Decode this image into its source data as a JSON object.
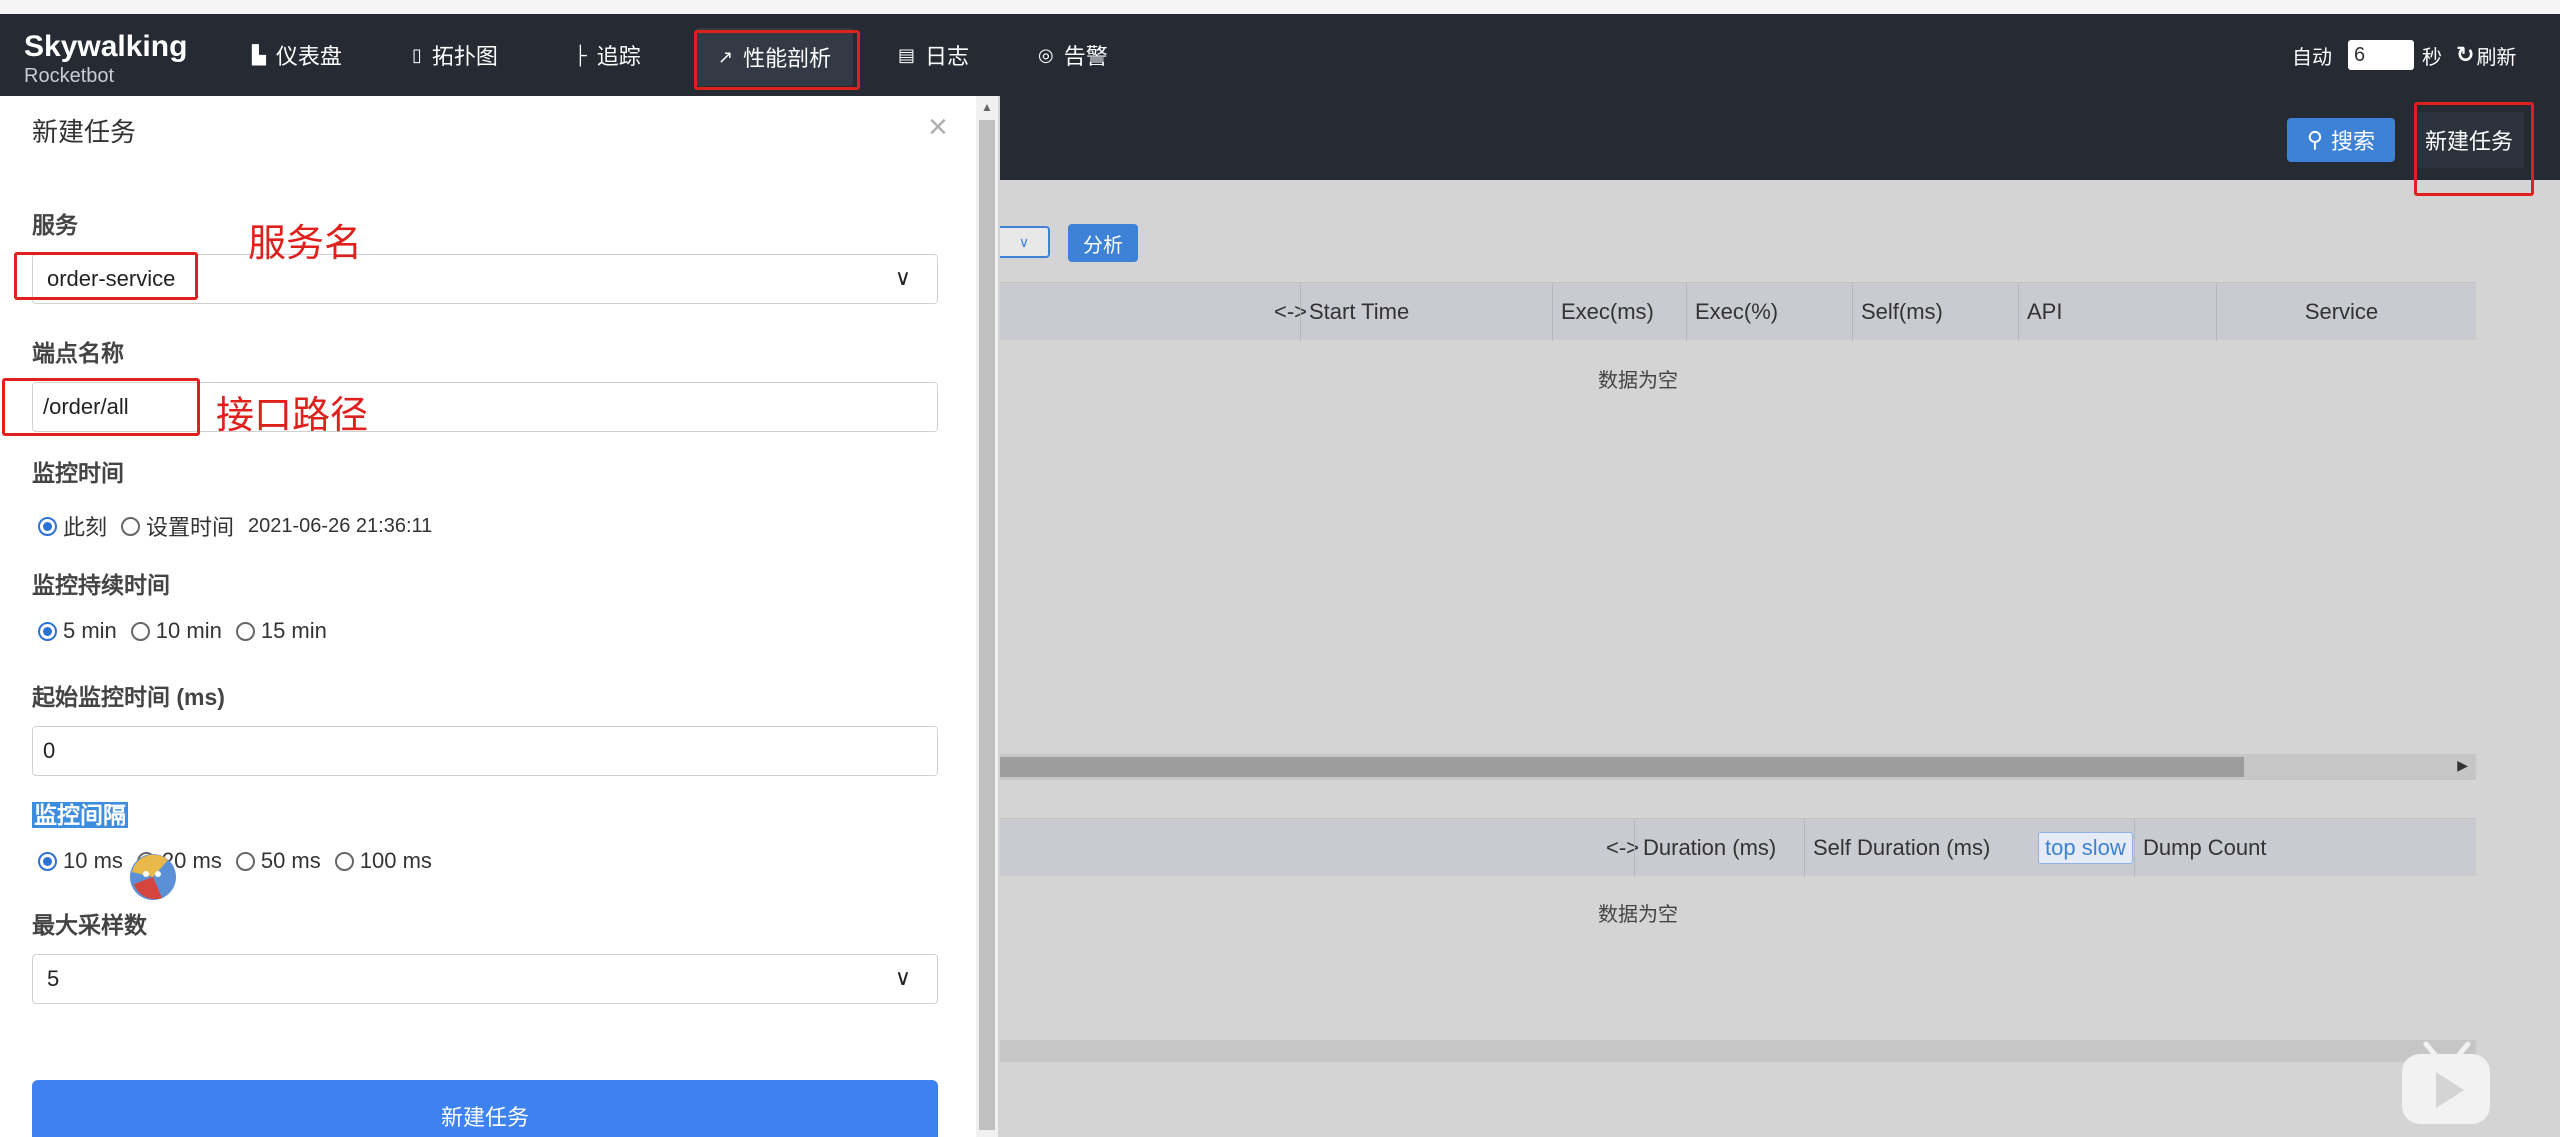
{
  "nav": {
    "logo_brand": "Skywalking",
    "logo_sub": "Rocketbot",
    "items": [
      {
        "icon": "chart-icon",
        "label": "仪表盘"
      },
      {
        "icon": "topology-icon",
        "label": "拓扑图"
      },
      {
        "icon": "trace-icon",
        "label": "追踪"
      },
      {
        "icon": "trend-icon",
        "label": "性能剖析"
      },
      {
        "icon": "log-icon",
        "label": "日志"
      },
      {
        "icon": "alarm-icon",
        "label": "告警"
      }
    ],
    "auto_label": "自动",
    "interval_value": "6",
    "seconds_label": "秒",
    "refresh_label": "刷新"
  },
  "toolbar": {
    "search_label": "搜索",
    "new_task_label": "新建任务",
    "analyze_label": "分析"
  },
  "top_table": {
    "toggle": "<->",
    "columns": [
      "Start Time",
      "Exec(ms)",
      "Exec(%)",
      "Self(ms)",
      "API",
      "Service"
    ],
    "empty": "数据为空"
  },
  "bottom_table": {
    "toggle": "<->",
    "columns": [
      "Duration (ms)",
      "Self Duration (ms)",
      "top slow",
      "Dump Count"
    ],
    "empty": "数据为空"
  },
  "modal": {
    "title": "新建任务",
    "close": "×",
    "service_label": "服务",
    "service_value": "order-service",
    "endpoint_label": "端点名称",
    "endpoint_value": "/order/all",
    "monitor_time_label": "监控时间",
    "monitor_time_options": [
      "此刻",
      "设置时间"
    ],
    "monitor_time_value": "2021-06-26 21:36:11",
    "duration_label": "监控持续时间",
    "duration_options": [
      "5 min",
      "10 min",
      "15 min"
    ],
    "start_label": "起始监控时间 (ms)",
    "start_value": "0",
    "interval_label": "监控间隔",
    "interval_options": [
      "10 ms",
      "20 ms",
      "50 ms",
      "100 ms"
    ],
    "max_samples_label": "最大采样数",
    "max_samples_value": "5",
    "submit_label": "新建任务"
  },
  "annotations": {
    "service_note": "服务名",
    "endpoint_note": "接口路径"
  },
  "colors": {
    "navbar": "#252a33",
    "accent": "#3d82d6",
    "annotation": "#e0201c"
  }
}
